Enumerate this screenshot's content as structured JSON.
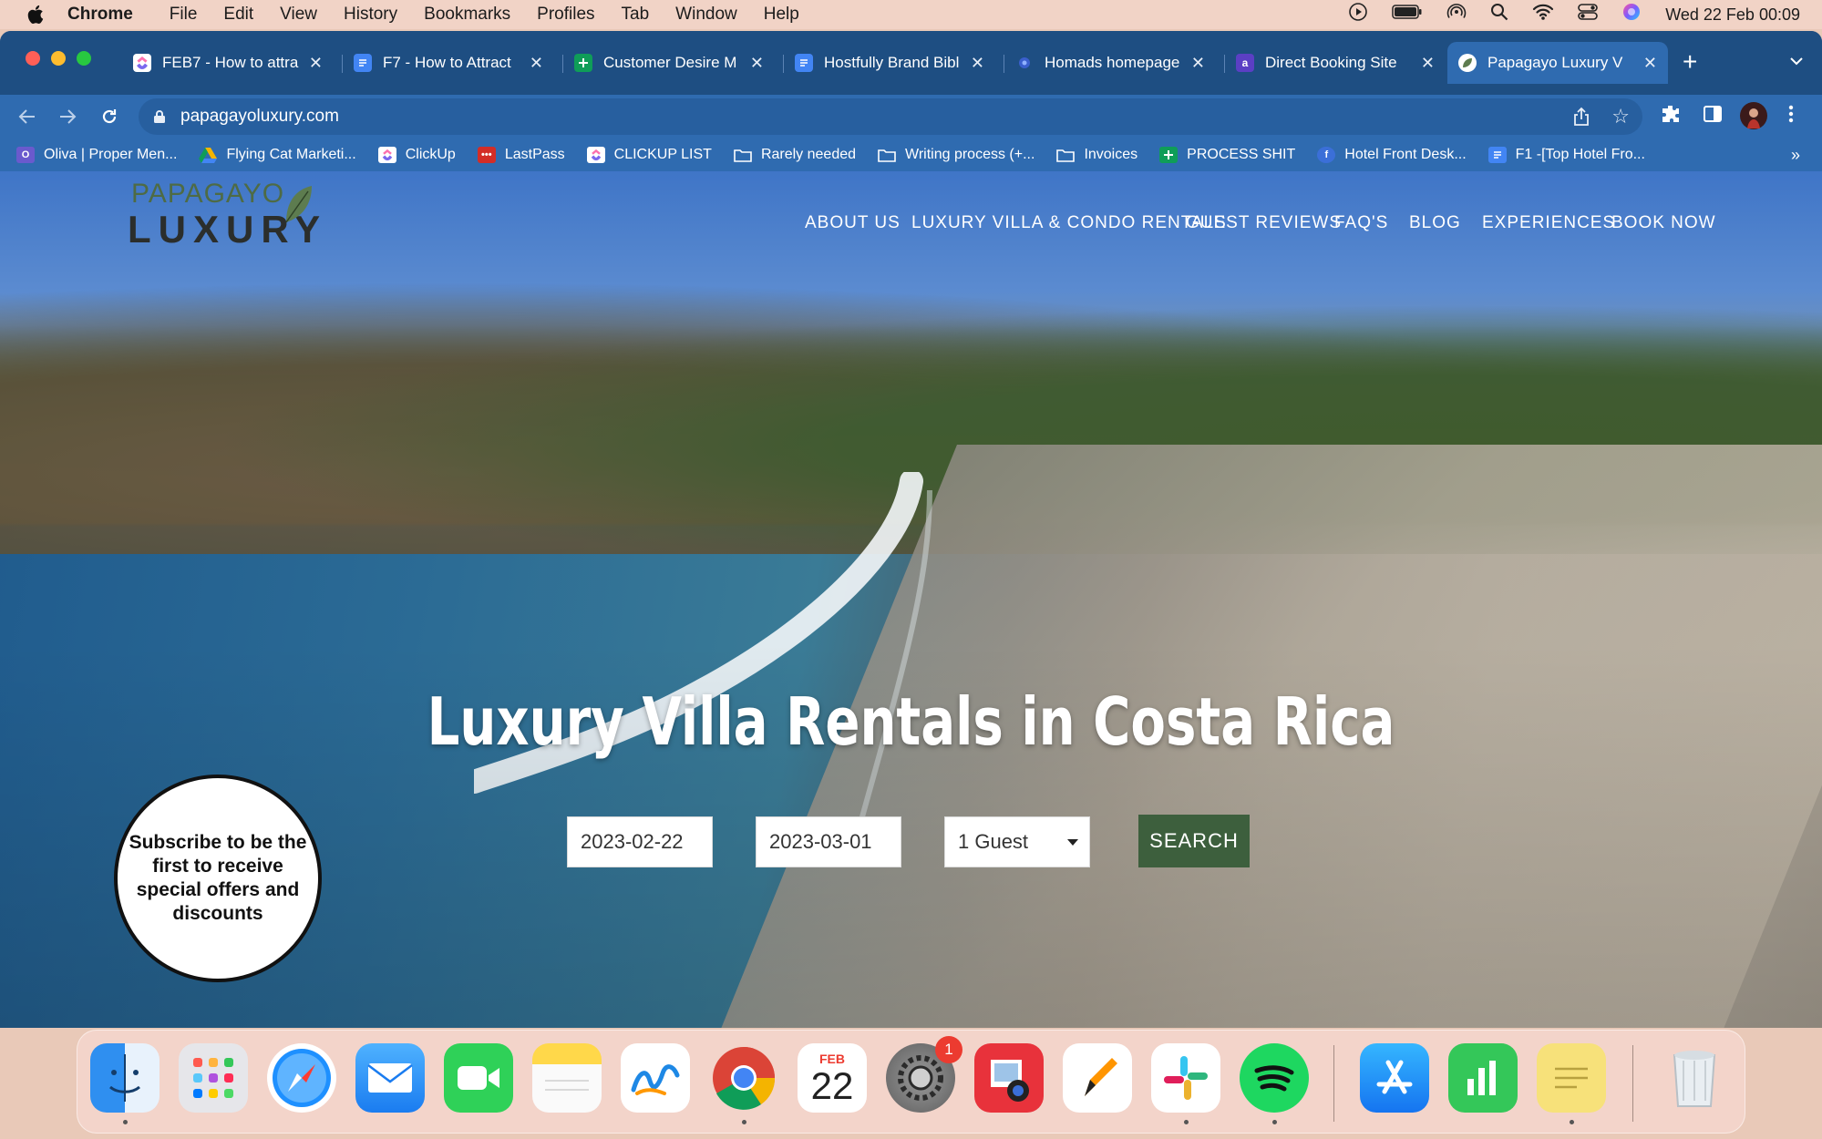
{
  "menubar": {
    "app_name": "Chrome",
    "menus": [
      "File",
      "Edit",
      "View",
      "History",
      "Bookmarks",
      "Profiles",
      "Tab",
      "Window",
      "Help"
    ],
    "clock": "Wed 22 Feb  00:09"
  },
  "tabs": [
    {
      "title": "FEB7 - How to attra",
      "icon": "clickup-icon",
      "color": "#e8453c"
    },
    {
      "title": "F7 - How to Attract",
      "icon": "google-docs-icon",
      "color": "#4285f4"
    },
    {
      "title": "Customer Desire M",
      "icon": "google-sheets-icon",
      "color": "#0f9d58"
    },
    {
      "title": "Hostfully Brand Bibl",
      "icon": "google-docs-icon",
      "color": "#4285f4"
    },
    {
      "title": "Homads homepage",
      "icon": "web-icon",
      "color": "#3a5fcd"
    },
    {
      "title": "Direct Booking Site",
      "icon": "web-icon",
      "color": "#5b3fc4"
    },
    {
      "title": "Papagayo Luxury V",
      "icon": "leaf-icon",
      "color": "#ffffff",
      "active": true
    }
  ],
  "address_bar": {
    "url": "papagayoluxury.com"
  },
  "bookmarks": [
    {
      "label": "Oliva | Proper Men...",
      "color": "#6a5acd"
    },
    {
      "label": "Flying Cat Marketi...",
      "color": "#f4b400"
    },
    {
      "label": "ClickUp",
      "color": "#e8453c"
    },
    {
      "label": "LastPass",
      "color": "#d32d27"
    },
    {
      "label": "CLICKUP LIST",
      "color": "#e8453c"
    },
    {
      "label": "Rarely needed",
      "color": "folder"
    },
    {
      "label": "Writing process (+...",
      "color": "folder"
    },
    {
      "label": "Invoices",
      "color": "folder"
    },
    {
      "label": "PROCESS SHIT",
      "color": "#0f9d58"
    },
    {
      "label": "Hotel Front Desk...",
      "color": "#3b6fd8"
    },
    {
      "label": "F1 -[Top Hotel Fro...",
      "color": "#4285f4"
    }
  ],
  "site": {
    "logo_top": "PAPAGAYO",
    "logo_bottom": "LUXURY",
    "nav": [
      "ABOUT US",
      "LUXURY VILLA & CONDO RENTALS",
      "GUEST REVIEWS",
      "FAQ'S",
      "BLOG",
      "EXPERIENCES",
      "BOOK NOW"
    ],
    "hero_title": "Luxury Villa Rentals in Costa Rica",
    "booking": {
      "checkin": "2023-02-22",
      "checkout": "2023-03-01",
      "guests": "1 Guest",
      "search_label": "SEARCH"
    },
    "subscribe_text": "Subscribe to be the first to receive special offers and discounts"
  },
  "dock": {
    "apps": [
      "finder",
      "launchpad",
      "safari",
      "mail",
      "facetime",
      "notes",
      "freeform",
      "chrome",
      "calendar",
      "system-settings",
      "photo-booth",
      "pages",
      "slack",
      "spotify",
      "app-store",
      "numbers",
      "stickies",
      "trash"
    ],
    "calendar_month": "FEB",
    "calendar_day": "22",
    "settings_badge": "1"
  }
}
